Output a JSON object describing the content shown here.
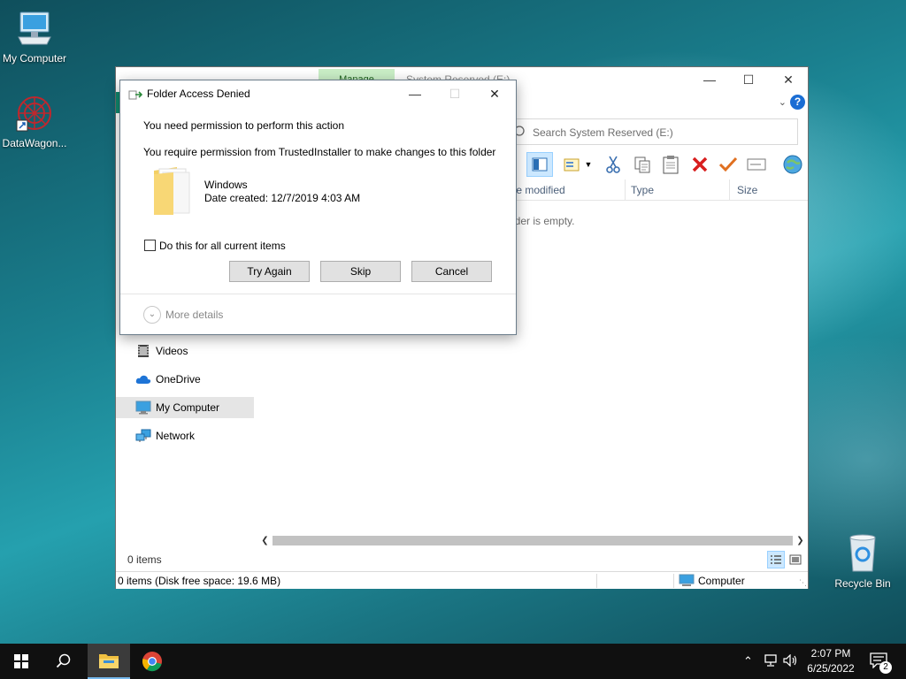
{
  "desktop": {
    "icons": [
      {
        "label": "My Computer"
      },
      {
        "label": "DataWagon..."
      },
      {
        "label": "Recycle Bin"
      }
    ]
  },
  "explorer": {
    "ribbon_tab": "Manage",
    "window_title": "System Reserved (E:)",
    "search_placeholder": "Search System Reserved (E:)",
    "columns": [
      "te modified",
      "Type",
      "Size"
    ],
    "empty_message": "lder is empty.",
    "nav": [
      {
        "label": "Videos",
        "icon": "videos-icon"
      },
      {
        "label": "OneDrive",
        "icon": "onedrive-icon"
      },
      {
        "label": "My Computer",
        "icon": "computer-icon",
        "selected": true
      },
      {
        "label": "Network",
        "icon": "network-icon"
      }
    ],
    "items_count": "0 items",
    "status_left": "0 items (Disk free space: 19.6 MB)",
    "status_right": "Computer"
  },
  "dialog": {
    "title": "Folder Access Denied",
    "line1": "You need permission to perform this action",
    "line2": "You require permission from TrustedInstaller to make changes to this folder",
    "folder_name": "Windows",
    "folder_date": "Date created: 12/7/2019 4:03 AM",
    "checkbox_label": "Do this for all current items",
    "checkbox_checked": false,
    "buttons": {
      "try_again": "Try Again",
      "skip": "Skip",
      "cancel": "Cancel"
    },
    "more_details": "More details"
  },
  "taskbar": {
    "time": "2:07 PM",
    "date": "6/25/2022",
    "notification_count": "2"
  },
  "colors": {
    "accent": "#0078d7",
    "manage_tab": "#c9eec6",
    "selection": "#e5e5e5"
  }
}
